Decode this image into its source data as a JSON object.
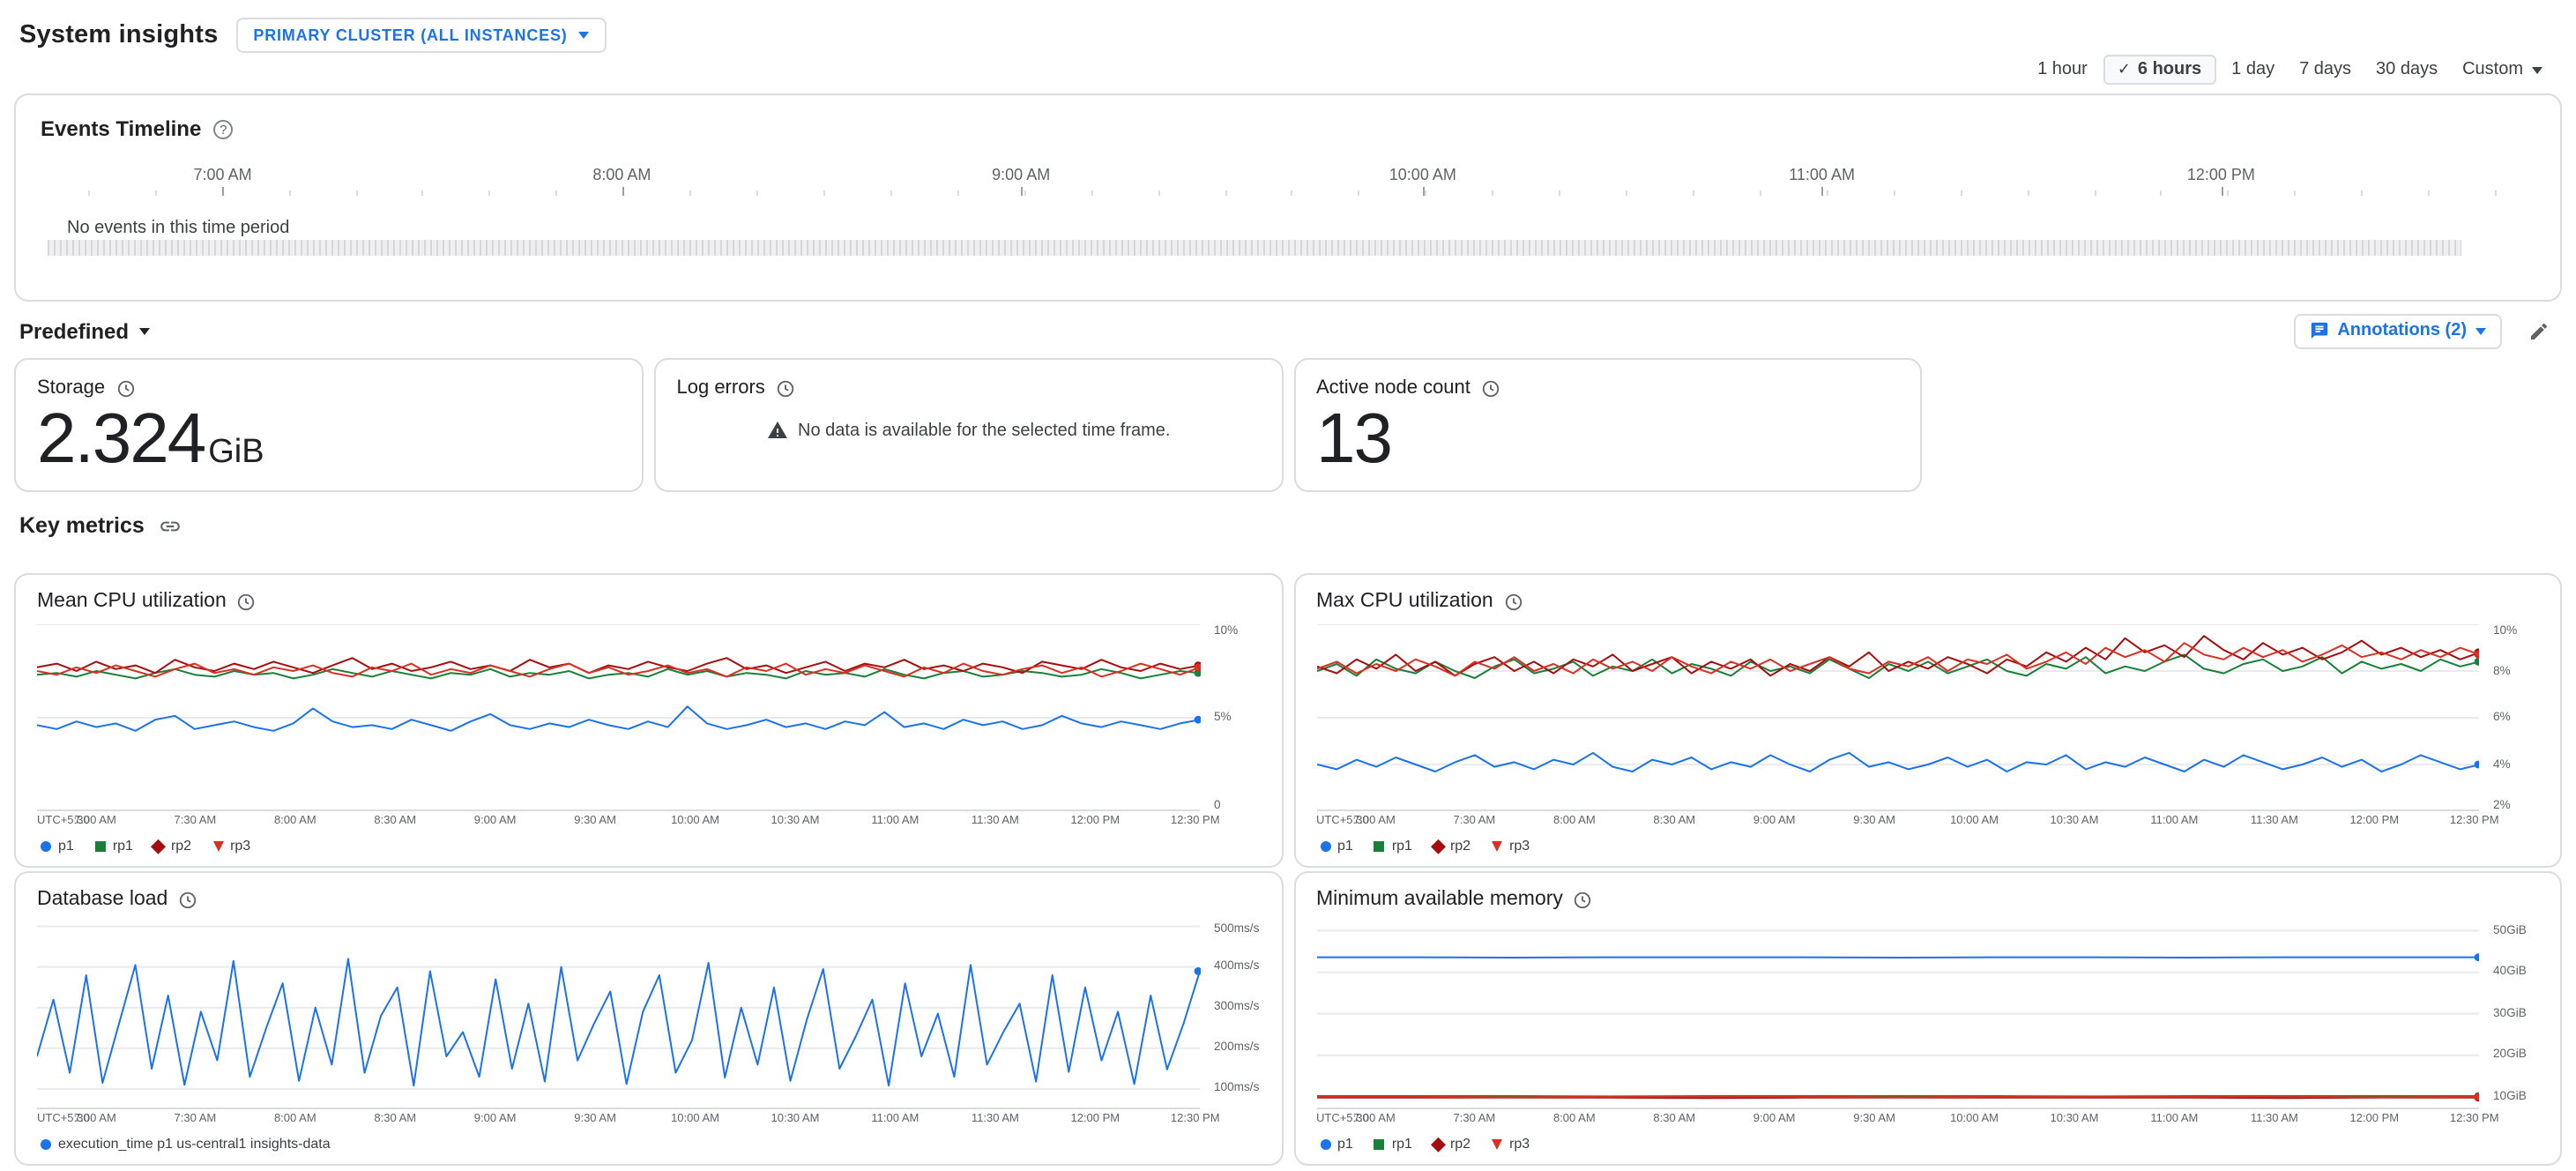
{
  "header": {
    "title": "System insights",
    "cluster_selector": "PRIMARY CLUSTER (ALL INSTANCES)",
    "time_ranges": [
      "1 hour",
      "6 hours",
      "1 day",
      "7 days",
      "30 days"
    ],
    "selected_time_range": "6 hours",
    "custom_label": "Custom"
  },
  "events_timeline": {
    "title": "Events Timeline",
    "axis_labels": [
      "7:00 AM",
      "8:00 AM",
      "9:00 AM",
      "10:00 AM",
      "11:00 AM",
      "12:00 PM"
    ],
    "empty_message": "No events in this time period"
  },
  "toolbar": {
    "predefined_label": "Predefined",
    "annotations_label": "Annotations (2)"
  },
  "summary_cards": [
    {
      "title": "Storage",
      "value": "2.324",
      "unit": "GiB"
    },
    {
      "title": "Log errors",
      "message": "No data is available for the selected time frame."
    },
    {
      "title": "Active node count",
      "value": "13",
      "unit": ""
    }
  ],
  "key_metrics_label": "Key metrics",
  "colors": {
    "accent_blue": "#1a73e8",
    "border_gray": "#dadce0",
    "text_secondary": "#5f6368"
  },
  "chart_data": {
    "mean_cpu": {
      "type": "line",
      "title": "Mean CPU utilization",
      "ylim": [
        0,
        10
      ],
      "yticks": [
        {
          "v": 0,
          "label": "0"
        },
        {
          "v": 5,
          "label": "5%"
        },
        {
          "v": 10,
          "label": "10%"
        }
      ],
      "xlabels": [
        "UTC+5:30",
        "7:00 AM",
        "7:30 AM",
        "8:00 AM",
        "8:30 AM",
        "9:00 AM",
        "9:30 AM",
        "10:00 AM",
        "10:30 AM",
        "11:00 AM",
        "11:30 AM",
        "12:00 PM",
        "12:30 PM"
      ],
      "legend_position": "bottom",
      "series": [
        {
          "name": "p1",
          "color": "#1a73e8",
          "shape": "circle",
          "values": [
            4.6,
            4.4,
            4.8,
            4.5,
            4.7,
            4.3,
            4.9,
            5.1,
            4.4,
            4.6,
            4.8,
            4.5,
            4.3,
            4.7,
            5.5,
            4.8,
            4.5,
            4.6,
            4.4,
            4.9,
            4.6,
            4.3,
            4.8,
            5.2,
            4.6,
            4.4,
            4.7,
            4.5,
            4.9,
            4.6,
            4.4,
            4.8,
            4.5,
            5.6,
            4.7,
            4.4,
            4.6,
            4.9,
            4.5,
            4.7,
            4.4,
            4.8,
            4.6,
            5.3,
            4.5,
            4.7,
            4.4,
            4.9,
            4.6,
            4.8,
            4.4,
            4.6,
            5.1,
            4.7,
            4.5,
            4.8,
            4.6,
            4.4,
            4.7,
            4.9
          ]
        },
        {
          "name": "rp1",
          "color": "#188038",
          "shape": "square",
          "values": [
            7.3,
            7.4,
            7.2,
            7.5,
            7.3,
            7.1,
            7.4,
            7.6,
            7.3,
            7.2,
            7.5,
            7.3,
            7.4,
            7.1,
            7.3,
            7.6,
            7.4,
            7.2,
            7.5,
            7.3,
            7.1,
            7.4,
            7.3,
            7.6,
            7.2,
            7.4,
            7.3,
            7.5,
            7.1,
            7.3,
            7.4,
            7.2,
            7.6,
            7.3,
            7.5,
            7.2,
            7.4,
            7.3,
            7.1,
            7.5,
            7.3,
            7.4,
            7.2,
            7.6,
            7.3,
            7.1,
            7.4,
            7.5,
            7.2,
            7.3,
            7.5,
            7.4,
            7.2,
            7.3,
            7.6,
            7.4,
            7.1,
            7.3,
            7.5,
            7.4
          ]
        },
        {
          "name": "rp2",
          "color": "#a50e0e",
          "shape": "diamond",
          "values": [
            7.7,
            7.9,
            7.5,
            8.0,
            7.6,
            7.8,
            7.4,
            8.1,
            7.7,
            7.5,
            7.9,
            7.6,
            8.0,
            7.7,
            7.4,
            7.8,
            8.2,
            7.6,
            7.9,
            7.5,
            7.7,
            8.0,
            7.6,
            7.8,
            7.5,
            8.1,
            7.7,
            7.9,
            7.4,
            7.8,
            7.6,
            8.0,
            7.7,
            7.5,
            7.9,
            8.2,
            7.6,
            7.8,
            7.4,
            7.7,
            8.0,
            7.5,
            7.9,
            7.7,
            8.1,
            7.6,
            7.8,
            7.5,
            7.9,
            7.7,
            7.4,
            8.0,
            7.8,
            7.6,
            8.1,
            7.7,
            7.5,
            7.9,
            7.6,
            7.8
          ]
        },
        {
          "name": "rp3",
          "color": "#d93025",
          "shape": "triangle",
          "values": [
            7.5,
            7.3,
            7.7,
            7.4,
            7.8,
            7.5,
            7.2,
            7.6,
            7.9,
            7.4,
            7.6,
            7.3,
            7.7,
            7.5,
            7.8,
            7.4,
            7.2,
            7.7,
            7.5,
            7.9,
            7.3,
            7.6,
            7.4,
            7.8,
            7.5,
            7.2,
            7.6,
            7.9,
            7.4,
            7.7,
            7.3,
            7.5,
            7.8,
            7.4,
            7.6,
            7.2,
            7.7,
            7.5,
            7.9,
            7.3,
            7.6,
            7.4,
            7.8,
            7.5,
            7.2,
            7.7,
            7.4,
            7.9,
            7.5,
            7.3,
            7.6,
            7.8,
            7.4,
            7.7,
            7.2,
            7.5,
            7.9,
            7.6,
            7.3,
            7.7
          ]
        }
      ]
    },
    "max_cpu": {
      "type": "line",
      "title": "Max CPU utilization",
      "ylim": [
        2,
        10
      ],
      "yticks": [
        {
          "v": 2,
          "label": "2%"
        },
        {
          "v": 4,
          "label": "4%"
        },
        {
          "v": 6,
          "label": "6%"
        },
        {
          "v": 8,
          "label": "8%"
        },
        {
          "v": 10,
          "label": "10%"
        }
      ],
      "xlabels": [
        "UTC+5:30",
        "7:00 AM",
        "7:30 AM",
        "8:00 AM",
        "8:30 AM",
        "9:00 AM",
        "9:30 AM",
        "10:00 AM",
        "10:30 AM",
        "11:00 AM",
        "11:30 AM",
        "12:00 PM",
        "12:30 PM"
      ],
      "legend_position": "bottom",
      "series": [
        {
          "name": "p1",
          "color": "#1a73e8",
          "shape": "circle",
          "values": [
            4.0,
            3.8,
            4.2,
            3.9,
            4.3,
            4.0,
            3.7,
            4.1,
            4.4,
            3.9,
            4.1,
            3.8,
            4.2,
            4.0,
            4.5,
            3.9,
            3.7,
            4.2,
            4.0,
            4.3,
            3.8,
            4.1,
            3.9,
            4.4,
            4.0,
            3.7,
            4.2,
            4.5,
            3.9,
            4.1,
            3.8,
            4.0,
            4.3,
            3.9,
            4.2,
            3.7,
            4.1,
            4.0,
            4.4,
            3.8,
            4.1,
            3.9,
            4.3,
            4.0,
            3.7,
            4.2,
            3.9,
            4.4,
            4.1,
            3.8,
            4.0,
            4.3,
            3.9,
            4.2,
            3.7,
            4.0,
            4.4,
            4.1,
            3.8,
            4.0
          ]
        },
        {
          "name": "rp1",
          "color": "#188038",
          "shape": "square",
          "values": [
            8.0,
            8.3,
            7.8,
            8.5,
            8.1,
            7.9,
            8.4,
            8.0,
            7.7,
            8.2,
            8.5,
            7.9,
            8.1,
            8.4,
            7.8,
            8.2,
            8.0,
            8.5,
            7.9,
            8.3,
            8.1,
            7.8,
            8.4,
            8.0,
            8.2,
            7.9,
            8.5,
            8.1,
            7.7,
            8.3,
            8.0,
            8.4,
            7.9,
            8.2,
            8.5,
            8.0,
            7.8,
            8.3,
            8.1,
            8.6,
            7.9,
            8.2,
            8.0,
            8.4,
            8.7,
            8.1,
            7.9,
            8.3,
            8.5,
            8.0,
            8.2,
            8.6,
            7.9,
            8.4,
            8.1,
            8.3,
            8.0,
            8.5,
            8.2,
            8.4
          ]
        },
        {
          "name": "rp2",
          "color": "#a50e0e",
          "shape": "diamond",
          "values": [
            8.2,
            7.9,
            8.5,
            8.1,
            8.7,
            8.0,
            8.4,
            7.8,
            8.3,
            8.6,
            8.0,
            8.4,
            7.9,
            8.5,
            8.2,
            8.7,
            8.0,
            8.3,
            8.6,
            7.9,
            8.4,
            8.1,
            8.5,
            7.8,
            8.3,
            8.0,
            8.6,
            8.2,
            8.8,
            8.0,
            8.4,
            8.1,
            8.6,
            8.3,
            7.9,
            8.5,
            8.2,
            8.8,
            8.4,
            9.0,
            8.5,
            9.4,
            8.8,
            9.1,
            8.6,
            9.5,
            8.9,
            8.5,
            9.2,
            8.7,
            9.0,
            8.5,
            8.8,
            9.3,
            8.7,
            9.0,
            8.6,
            8.9,
            8.5,
            8.8
          ]
        },
        {
          "name": "rp3",
          "color": "#d93025",
          "shape": "triangle",
          "values": [
            8.1,
            8.4,
            7.9,
            8.3,
            8.0,
            8.5,
            8.2,
            7.8,
            8.4,
            8.1,
            8.6,
            8.0,
            8.3,
            7.9,
            8.5,
            8.1,
            8.4,
            8.0,
            8.6,
            8.2,
            7.9,
            8.4,
            8.1,
            8.5,
            8.0,
            8.3,
            8.6,
            8.1,
            7.9,
            8.4,
            8.2,
            8.6,
            8.0,
            8.5,
            8.3,
            8.7,
            8.1,
            8.4,
            8.8,
            8.3,
            9.0,
            8.6,
            8.9,
            8.4,
            9.2,
            8.7,
            8.5,
            9.0,
            8.6,
            8.9,
            8.4,
            8.7,
            9.1,
            8.6,
            8.8,
            8.5,
            8.9,
            8.6,
            9.0,
            8.7
          ]
        }
      ]
    },
    "db_load": {
      "type": "line",
      "title": "Database load",
      "ylim": [
        50,
        510
      ],
      "yticks": [
        {
          "v": 100,
          "label": "100ms/s"
        },
        {
          "v": 200,
          "label": "200ms/s"
        },
        {
          "v": 300,
          "label": "300ms/s"
        },
        {
          "v": 400,
          "label": "400ms/s"
        },
        {
          "v": 500,
          "label": "500ms/s"
        }
      ],
      "xlabels": [
        "UTC+5:30",
        "7:00 AM",
        "7:30 AM",
        "8:00 AM",
        "8:30 AM",
        "9:00 AM",
        "9:30 AM",
        "10:00 AM",
        "10:30 AM",
        "11:00 AM",
        "11:30 AM",
        "12:00 PM",
        "12:30 PM"
      ],
      "legend_position": "bottom",
      "series": [
        {
          "name": "execution_time p1 us-central1 insights-data",
          "color": "#1a73e8",
          "shape": "circle",
          "values": [
            180,
            320,
            140,
            380,
            115,
            260,
            405,
            150,
            330,
            110,
            290,
            170,
            415,
            130,
            250,
            360,
            120,
            300,
            160,
            420,
            140,
            280,
            350,
            108,
            390,
            180,
            240,
            130,
            370,
            150,
            310,
            118,
            400,
            170,
            260,
            340,
            112,
            290,
            380,
            140,
            220,
            410,
            128,
            300,
            160,
            350,
            120,
            270,
            395,
            150,
            230,
            320,
            108,
            360,
            180,
            285,
            130,
            405,
            160,
            240,
            310,
            118,
            380,
            142,
            350,
            170,
            290,
            112,
            330,
            148,
            260,
            390
          ]
        }
      ]
    },
    "min_memory": {
      "type": "line",
      "title": "Minimum available memory",
      "ylim": [
        7,
        52
      ],
      "yticks": [
        {
          "v": 10,
          "label": "10GiB"
        },
        {
          "v": 20,
          "label": "20GiB"
        },
        {
          "v": 30,
          "label": "30GiB"
        },
        {
          "v": 40,
          "label": "40GiB"
        },
        {
          "v": 50,
          "label": "50GiB"
        }
      ],
      "xlabels": [
        "UTC+5:30",
        "7:00 AM",
        "7:30 AM",
        "8:00 AM",
        "8:30 AM",
        "9:00 AM",
        "9:30 AM",
        "10:00 AM",
        "10:30 AM",
        "11:00 AM",
        "11:30 AM",
        "12:00 PM",
        "12:30 PM"
      ],
      "legend_position": "bottom",
      "series": [
        {
          "name": "p1",
          "color": "#1a73e8",
          "shape": "circle",
          "values": [
            43.6,
            43.6,
            43.5,
            43.6,
            43.6,
            43.6,
            43.5,
            43.6,
            43.6,
            43.5,
            43.6,
            43.6,
            43.6
          ]
        },
        {
          "name": "rp1",
          "color": "#188038",
          "shape": "square",
          "values": [
            10.2,
            10.2,
            10.2,
            10.1,
            10.2,
            10.2,
            10.2,
            10.2,
            10.1,
            10.2,
            10.2,
            10.2,
            10.2
          ]
        },
        {
          "name": "rp2",
          "color": "#a50e0e",
          "shape": "diamond",
          "values": [
            9.8,
            9.8,
            9.8,
            9.8,
            9.7,
            9.8,
            9.8,
            9.8,
            9.8,
            9.8,
            9.7,
            9.8,
            9.8
          ]
        },
        {
          "name": "rp3",
          "color": "#d93025",
          "shape": "triangle",
          "values": [
            10.0,
            10.0,
            9.9,
            10.0,
            10.0,
            10.0,
            9.9,
            10.0,
            10.0,
            10.0,
            10.0,
            9.9,
            10.0
          ]
        }
      ]
    }
  }
}
